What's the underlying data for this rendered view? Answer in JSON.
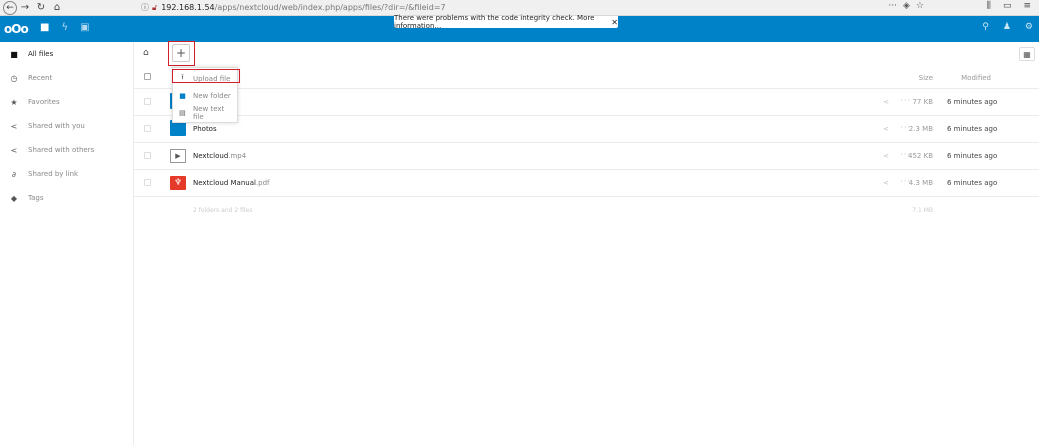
{
  "browser": {
    "url_host": "192.168.1.54",
    "url_path": "/apps/nextcloud/web/index.php/apps/files/?dir=/&fileid=7"
  },
  "header": {
    "logo_text": "oOo",
    "warning_text": "There were problems with the code integrity check. More information…",
    "warning_close": "✕"
  },
  "sidebar": {
    "items": [
      {
        "label": "All files",
        "icon": "folder-icon"
      },
      {
        "label": "Recent",
        "icon": "clock-icon"
      },
      {
        "label": "Favorites",
        "icon": "star-icon"
      },
      {
        "label": "Shared with you",
        "icon": "share-icon"
      },
      {
        "label": "Shared with others",
        "icon": "share-icon"
      },
      {
        "label": "Shared by link",
        "icon": "link-icon"
      },
      {
        "label": "Tags",
        "icon": "tag-icon"
      }
    ]
  },
  "new_menu": {
    "items": [
      {
        "label": "Upload file",
        "icon": "upload-icon"
      },
      {
        "label": "New folder",
        "icon": "folder-icon"
      },
      {
        "label": "New text file",
        "icon": "text-file-icon"
      }
    ]
  },
  "table": {
    "header_size": "Size",
    "header_modified": "Modified",
    "files": [
      {
        "name": "",
        "ext": "",
        "type": "folder",
        "size": "77 KB",
        "modified": "6 minutes ago"
      },
      {
        "name": "Photos",
        "ext": "",
        "type": "folder",
        "size": "2.3 MB",
        "modified": "6 minutes ago"
      },
      {
        "name": "Nextcloud",
        "ext": ".mp4",
        "type": "video",
        "size": "452 KB",
        "modified": "6 minutes ago"
      },
      {
        "name": "Nextcloud Manual",
        "ext": ".pdf",
        "type": "pdf",
        "size": "4.3 MB",
        "modified": "6 minutes ago"
      }
    ],
    "summary_text": "2 folders and 2 files",
    "summary_size": "7.1 MB"
  },
  "colors": {
    "brand": "#0082c9",
    "highlight": "#d0202e",
    "pdf": "#e53a2a"
  }
}
